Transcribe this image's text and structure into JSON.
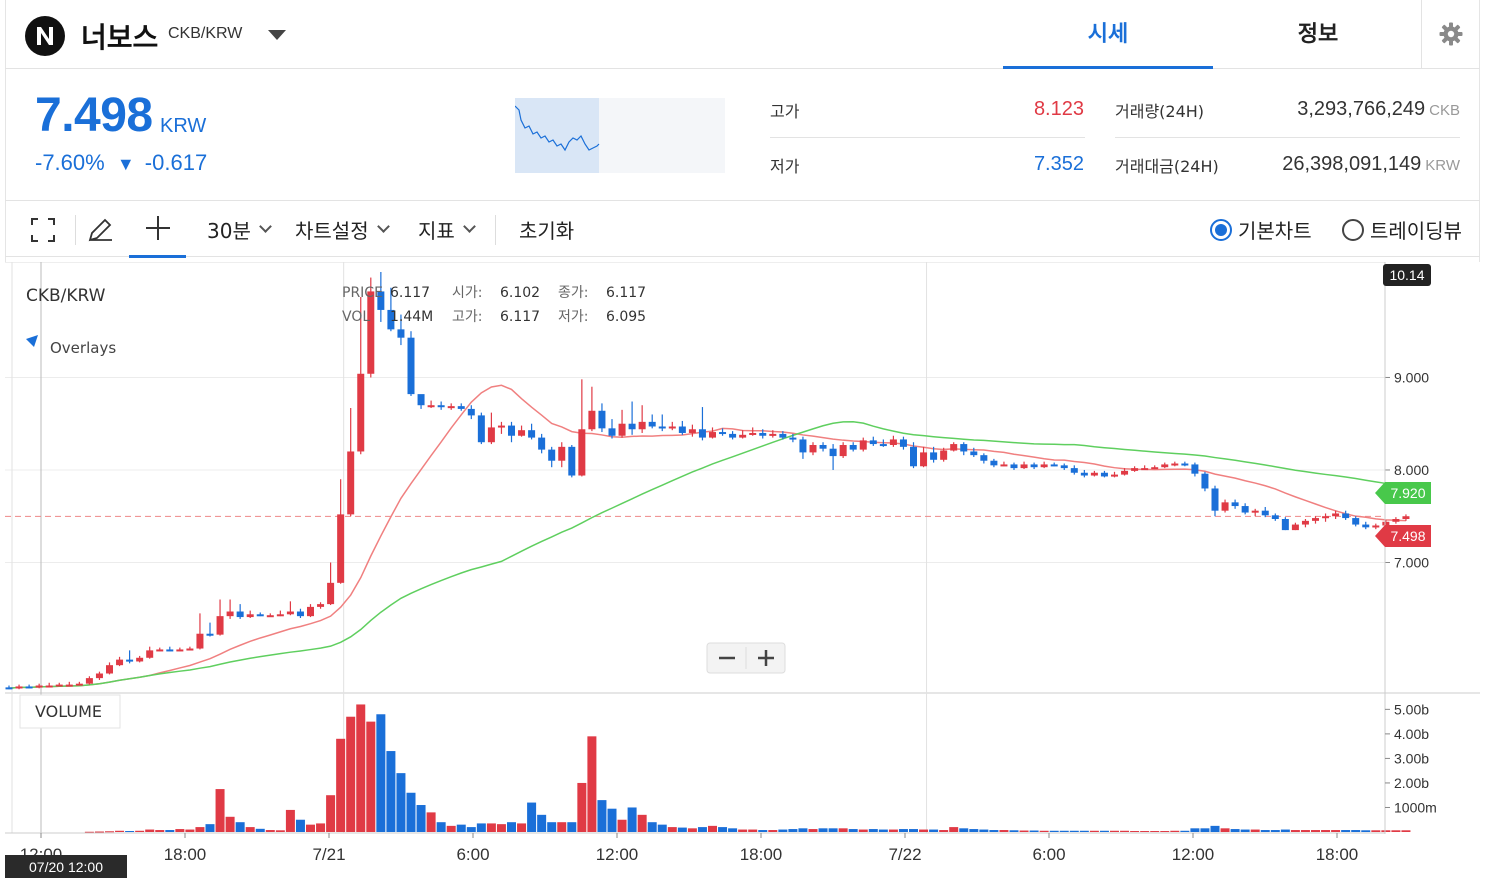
{
  "header": {
    "coin_name": "너보스",
    "pair": "CKB/KRW",
    "tabs": [
      "시세",
      "정보"
    ],
    "logo_icon": "nervos-logo",
    "settings_icon": "gear-icon"
  },
  "summary": {
    "price": "7.498",
    "unit": "KRW",
    "change_pct": "-7.60%",
    "change_arrow": "▼",
    "change_abs": "-0.617",
    "high_label": "고가",
    "high_value": "8.123",
    "low_label": "저가",
    "low_value": "7.352",
    "volume_label": "거래량(24H)",
    "volume_value": "3,293,766,249",
    "volume_unit": "CKB",
    "amount_label": "거래대금(24H)",
    "amount_value": "26,398,091,149",
    "amount_unit": "KRW",
    "colors": {
      "up": "#e03a45",
      "down": "#1a6fd8"
    }
  },
  "toolbar": {
    "interval": "30분",
    "chart_settings": "차트설정",
    "indicators": "지표",
    "reset": "초기화",
    "mode_basic": "기본차트",
    "mode_tradingview": "트레이딩뷰"
  },
  "chart_info": {
    "symbol": "CKB/KRW",
    "overlays": "Overlays",
    "price_label": "PRICE",
    "price_value": "6.117",
    "vol_label": "VOL",
    "vol_value": "1.44M",
    "open_label": "시가:",
    "open_value": "6.102",
    "high_label": "고가:",
    "high_value": "6.117",
    "close_label": "종가:",
    "close_value": "6.117",
    "low_label": "저가:",
    "low_value": "6.095",
    "volume_panel_label": "VOLUME",
    "crosshair_time": "07/20 12:00",
    "top_badge": "10.14",
    "ma_long_badge": "7.920",
    "last_price_badge": "7.498"
  },
  "chart_data": {
    "type": "candlestick",
    "interval": "30m",
    "y_ticks": [
      "9.000",
      "8.000",
      "7.000"
    ],
    "ylim": [
      5.6,
      10.14
    ],
    "volume_ticks": [
      "5.00b",
      "4.00b",
      "3.00b",
      "2.00b",
      "1000m"
    ],
    "volume_ylim_b": [
      0,
      5.3
    ],
    "x_ticks": [
      "12:00",
      "18:00",
      "7/21",
      "6:00",
      "12:00",
      "18:00",
      "7/22",
      "6:00",
      "12:00",
      "18:00"
    ],
    "candles": [
      [
        5.65,
        5.64,
        5.67,
        5.63,
        0
      ],
      [
        5.64,
        5.66,
        5.68,
        5.63,
        0
      ],
      [
        5.66,
        5.65,
        5.68,
        5.64,
        0
      ],
      [
        5.65,
        5.67,
        5.69,
        5.64,
        0
      ],
      [
        5.67,
        5.67,
        5.7,
        5.65,
        0
      ],
      [
        5.67,
        5.68,
        5.7,
        5.66,
        0
      ],
      [
        5.68,
        5.68,
        5.71,
        5.67,
        0
      ],
      [
        5.68,
        5.69,
        5.71,
        5.67,
        0
      ],
      [
        5.69,
        5.75,
        5.77,
        5.68,
        0.01
      ],
      [
        5.75,
        5.8,
        5.82,
        5.73,
        0.02
      ],
      [
        5.8,
        5.89,
        5.92,
        5.79,
        0.03
      ],
      [
        5.89,
        5.95,
        5.98,
        5.88,
        0.05
      ],
      [
        5.95,
        5.93,
        6.05,
        5.91,
        0.04
      ],
      [
        5.93,
        5.97,
        5.99,
        5.92,
        0.05
      ],
      [
        5.97,
        6.05,
        6.09,
        5.96,
        0.1
      ],
      [
        6.05,
        6.06,
        6.08,
        6.04,
        0.08
      ],
      [
        6.06,
        6.05,
        6.09,
        6.04,
        0.08
      ],
      [
        6.05,
        6.06,
        6.08,
        6.04,
        0.12
      ],
      [
        6.06,
        6.07,
        6.09,
        6.05,
        0.1
      ],
      [
        6.07,
        6.23,
        6.45,
        6.06,
        0.2
      ],
      [
        6.23,
        6.22,
        6.35,
        6.2,
        0.32
      ],
      [
        6.22,
        6.42,
        6.6,
        6.21,
        1.75
      ],
      [
        6.42,
        6.47,
        6.6,
        6.39,
        0.62
      ],
      [
        6.47,
        6.41,
        6.55,
        6.39,
        0.4
      ],
      [
        6.41,
        6.44,
        6.48,
        6.4,
        0.2
      ],
      [
        6.44,
        6.43,
        6.46,
        6.42,
        0.13
      ],
      [
        6.43,
        6.43,
        6.45,
        6.42,
        0.08
      ],
      [
        6.43,
        6.44,
        6.48,
        6.42,
        0.07
      ],
      [
        6.44,
        6.47,
        6.58,
        6.43,
        0.9
      ],
      [
        6.47,
        6.42,
        6.5,
        6.4,
        0.5
      ],
      [
        6.42,
        6.52,
        6.55,
        6.41,
        0.3
      ],
      [
        6.52,
        6.55,
        6.57,
        6.5,
        0.35
      ],
      [
        6.55,
        6.78,
        7.0,
        6.54,
        1.5
      ],
      [
        6.78,
        7.52,
        7.9,
        6.77,
        3.8
      ],
      [
        7.52,
        8.2,
        8.67,
        7.5,
        4.7
      ],
      [
        8.2,
        9.04,
        9.87,
        8.17,
        5.2
      ],
      [
        9.04,
        9.93,
        10.08,
        9.0,
        4.5
      ],
      [
        9.93,
        9.73,
        10.14,
        9.6,
        4.8
      ],
      [
        9.73,
        9.52,
        9.97,
        9.5,
        3.3
      ],
      [
        9.52,
        9.43,
        9.68,
        9.35,
        2.4
      ],
      [
        9.43,
        8.82,
        9.5,
        8.8,
        1.6
      ],
      [
        8.82,
        8.7,
        8.78,
        8.66,
        1.1
      ],
      [
        8.7,
        8.7,
        8.75,
        8.67,
        0.8
      ],
      [
        8.7,
        8.68,
        8.74,
        8.65,
        0.4
      ],
      [
        8.68,
        8.69,
        8.72,
        8.65,
        0.25
      ],
      [
        8.69,
        8.66,
        8.72,
        8.64,
        0.3
      ],
      [
        8.66,
        8.59,
        8.7,
        8.55,
        0.2
      ],
      [
        8.59,
        8.3,
        8.62,
        8.28,
        0.35
      ],
      [
        8.3,
        8.46,
        8.62,
        8.28,
        0.35
      ],
      [
        8.46,
        8.48,
        8.52,
        8.39,
        0.32
      ],
      [
        8.48,
        8.37,
        8.52,
        8.3,
        0.4
      ],
      [
        8.37,
        8.43,
        8.48,
        8.36,
        0.35
      ],
      [
        8.43,
        8.35,
        8.5,
        8.33,
        1.2
      ],
      [
        8.35,
        8.22,
        8.39,
        8.18,
        0.7
      ],
      [
        8.22,
        8.1,
        8.25,
        8.03,
        0.4
      ],
      [
        8.1,
        8.25,
        8.3,
        8.03,
        0.4
      ],
      [
        8.25,
        7.94,
        8.27,
        7.92,
        0.4
      ],
      [
        7.94,
        8.44,
        8.98,
        7.93,
        2.0
      ],
      [
        8.44,
        8.64,
        8.9,
        8.42,
        3.9
      ],
      [
        8.64,
        8.45,
        8.72,
        8.41,
        1.3
      ],
      [
        8.45,
        8.37,
        8.55,
        8.34,
        0.95
      ],
      [
        8.37,
        8.5,
        8.65,
        8.35,
        0.5
      ],
      [
        8.5,
        8.44,
        8.74,
        8.38,
        1.0
      ],
      [
        8.44,
        8.52,
        8.7,
        8.4,
        0.7
      ],
      [
        8.52,
        8.47,
        8.6,
        8.45,
        0.4
      ],
      [
        8.47,
        8.46,
        8.6,
        8.42,
        0.3
      ],
      [
        8.46,
        8.47,
        8.52,
        8.43,
        0.2
      ],
      [
        8.47,
        8.4,
        8.53,
        8.38,
        0.18
      ],
      [
        8.4,
        8.44,
        8.49,
        8.36,
        0.15
      ],
      [
        8.44,
        8.35,
        8.68,
        8.32,
        0.2
      ],
      [
        8.35,
        8.41,
        8.46,
        8.34,
        0.25
      ],
      [
        8.41,
        8.39,
        8.45,
        8.37,
        0.2
      ],
      [
        8.39,
        8.35,
        8.42,
        8.33,
        0.15
      ],
      [
        8.35,
        8.38,
        8.43,
        8.34,
        0.1
      ],
      [
        8.38,
        8.4,
        8.46,
        8.37,
        0.1
      ],
      [
        8.4,
        8.37,
        8.44,
        8.34,
        0.08
      ],
      [
        8.37,
        8.39,
        8.43,
        8.35,
        0.08
      ],
      [
        8.39,
        8.35,
        8.42,
        8.33,
        0.1
      ],
      [
        8.35,
        8.33,
        8.39,
        8.3,
        0.12
      ],
      [
        8.33,
        8.19,
        8.36,
        8.12,
        0.15
      ],
      [
        8.19,
        8.27,
        8.3,
        8.16,
        0.12
      ],
      [
        8.27,
        8.23,
        8.3,
        8.2,
        0.15
      ],
      [
        8.23,
        8.15,
        8.28,
        8.0,
        0.15
      ],
      [
        8.15,
        8.27,
        8.3,
        8.13,
        0.15
      ],
      [
        8.27,
        8.22,
        8.3,
        8.2,
        0.12
      ],
      [
        8.22,
        8.32,
        8.35,
        8.2,
        0.1
      ],
      [
        8.32,
        8.28,
        8.36,
        8.26,
        0.12
      ],
      [
        8.28,
        8.27,
        8.33,
        8.25,
        0.1
      ],
      [
        8.27,
        8.33,
        8.37,
        8.25,
        0.1
      ],
      [
        8.33,
        8.25,
        8.36,
        8.22,
        0.12
      ],
      [
        8.25,
        8.04,
        8.3,
        8.02,
        0.12
      ],
      [
        8.04,
        8.19,
        8.25,
        8.03,
        0.1
      ],
      [
        8.19,
        8.11,
        8.25,
        8.08,
        0.1
      ],
      [
        8.11,
        8.21,
        8.24,
        8.09,
        0.08
      ],
      [
        8.21,
        8.28,
        8.3,
        8.2,
        0.2
      ],
      [
        8.28,
        8.2,
        8.3,
        8.16,
        0.15
      ],
      [
        8.2,
        8.16,
        8.24,
        8.14,
        0.12
      ],
      [
        8.16,
        8.1,
        8.18,
        8.07,
        0.1
      ],
      [
        8.1,
        8.05,
        8.12,
        8.03,
        0.08
      ],
      [
        8.05,
        8.06,
        8.09,
        8.04,
        0.08
      ],
      [
        8.06,
        8.02,
        8.08,
        8.0,
        0.07
      ],
      [
        8.02,
        8.06,
        8.09,
        8.01,
        0.06
      ],
      [
        8.06,
        8.03,
        8.08,
        8.01,
        0.06
      ],
      [
        8.03,
        8.06,
        8.09,
        8.02,
        0.05
      ],
      [
        8.06,
        8.05,
        8.08,
        8.04,
        0.05
      ],
      [
        8.05,
        8.02,
        8.07,
        8.0,
        0.05
      ],
      [
        8.02,
        7.97,
        8.05,
        7.95,
        0.05
      ],
      [
        7.97,
        7.94,
        8.0,
        7.92,
        0.05
      ],
      [
        7.94,
        7.97,
        7.99,
        7.93,
        0.05
      ],
      [
        7.97,
        7.93,
        7.99,
        7.92,
        0.05
      ],
      [
        7.93,
        7.95,
        7.98,
        7.92,
        0.05
      ],
      [
        7.95,
        7.99,
        8.02,
        7.94,
        0.05
      ],
      [
        7.99,
        8.02,
        8.04,
        7.98,
        0.04
      ],
      [
        8.02,
        8.02,
        8.05,
        8.0,
        0.04
      ],
      [
        8.02,
        8.03,
        8.05,
        8.01,
        0.04
      ],
      [
        8.03,
        8.06,
        8.08,
        8.02,
        0.04
      ],
      [
        8.06,
        8.07,
        8.09,
        8.04,
        0.05
      ],
      [
        8.07,
        8.06,
        8.09,
        8.04,
        0.05
      ],
      [
        8.06,
        7.96,
        8.08,
        7.93,
        0.15
      ],
      [
        7.96,
        7.8,
        7.98,
        7.77,
        0.15
      ],
      [
        7.8,
        7.56,
        7.83,
        7.5,
        0.25
      ],
      [
        7.56,
        7.65,
        7.68,
        7.54,
        0.15
      ],
      [
        7.65,
        7.61,
        7.68,
        7.58,
        0.12
      ],
      [
        7.61,
        7.54,
        7.64,
        7.52,
        0.1
      ],
      [
        7.54,
        7.56,
        7.58,
        7.5,
        0.1
      ],
      [
        7.56,
        7.51,
        7.6,
        7.49,
        0.08
      ],
      [
        7.51,
        7.47,
        7.53,
        7.45,
        0.08
      ],
      [
        7.47,
        7.35,
        7.49,
        7.35,
        0.1
      ],
      [
        7.35,
        7.41,
        7.43,
        7.35,
        0.08
      ],
      [
        7.41,
        7.45,
        7.47,
        7.38,
        0.08
      ],
      [
        7.45,
        7.48,
        7.5,
        7.42,
        0.08
      ],
      [
        7.48,
        7.5,
        7.53,
        7.44,
        0.08
      ],
      [
        7.5,
        7.53,
        7.56,
        7.47,
        0.08
      ],
      [
        7.53,
        7.48,
        7.56,
        7.46,
        0.08
      ],
      [
        7.48,
        7.41,
        7.5,
        7.39,
        0.08
      ],
      [
        7.41,
        7.38,
        7.44,
        7.36,
        0.07
      ],
      [
        7.38,
        7.4,
        7.42,
        7.36,
        0.07
      ],
      [
        7.4,
        7.44,
        7.46,
        7.38,
        0.07
      ],
      [
        7.44,
        7.47,
        7.49,
        7.42,
        0.07
      ],
      [
        7.47,
        7.5,
        7.52,
        7.45,
        0.07
      ]
    ],
    "ma_short_last": 7.5,
    "ma_long_last": 7.92
  }
}
